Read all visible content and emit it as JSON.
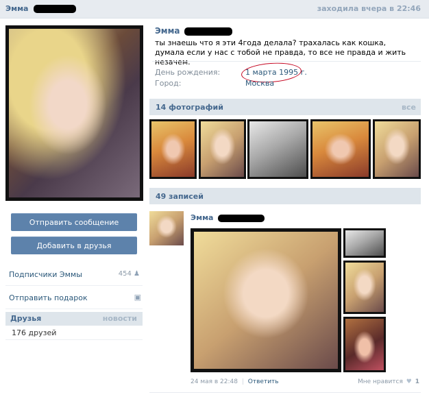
{
  "topbar": {
    "name": "Эмма",
    "status": "заходила вчера в 22:46"
  },
  "profile": {
    "name": "Эмма",
    "status_text": "ты знаешь что я эти 4года делала? трахалась как кошка, думала если у нас с тобой не правда, то все не правда и жить незачем.",
    "info": [
      {
        "label": "День рождения:",
        "value": "1 марта 1995 г."
      },
      {
        "label": "Город:",
        "value": "Москва"
      }
    ]
  },
  "sidebar": {
    "send_message": "Отправить сообщение",
    "add_friend": "Добавить в друзья",
    "subscribers": {
      "label": "Подписчики Эммы",
      "count": "454"
    },
    "gift": {
      "label": "Отправить подарок"
    },
    "friends": {
      "title": "Друзья",
      "news": "новости",
      "count_text": "176 друзей"
    }
  },
  "photos": {
    "title": "14 фотографий",
    "all": "все"
  },
  "posts": {
    "title": "49 записей",
    "post": {
      "author": "Эмма",
      "date": "24 мая в 22:48",
      "reply": "Ответить",
      "like_label": "Мне нравится",
      "like_count": "1"
    }
  },
  "icons": [
    "person-icon",
    "gift-icon",
    "heart-icon"
  ]
}
